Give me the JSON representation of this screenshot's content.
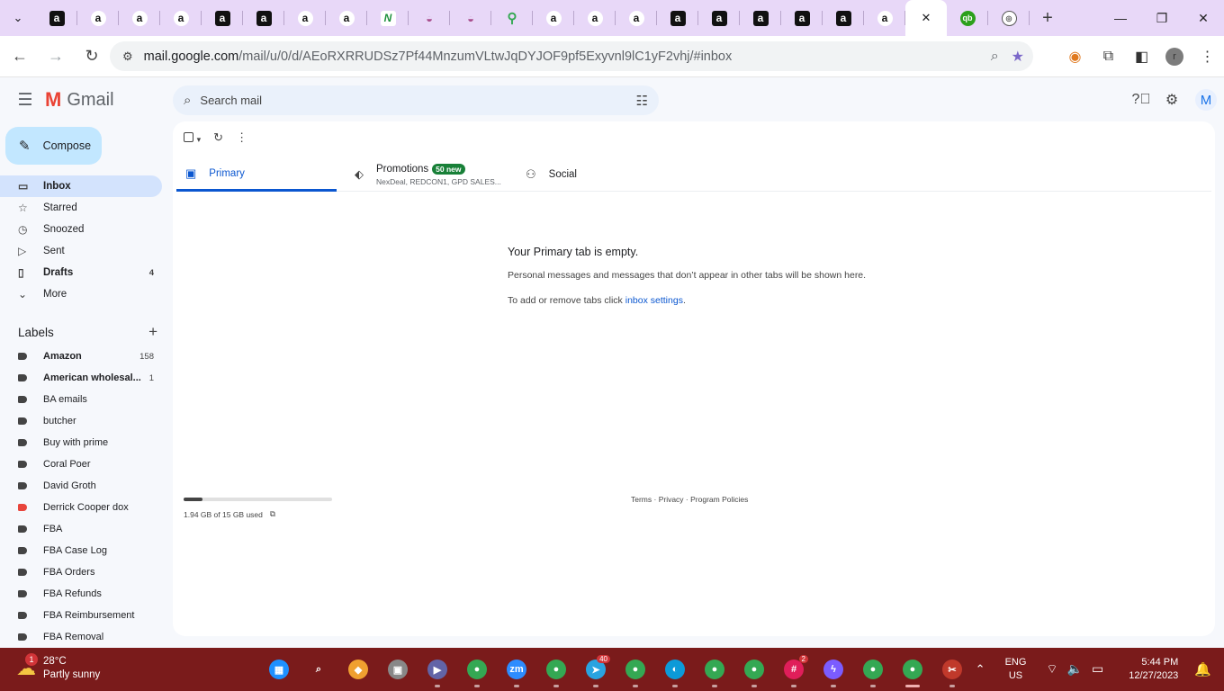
{
  "browser": {
    "tabs": [
      {
        "icon": "amazon-seller-icon",
        "glyph": "a",
        "style": "amz-dark"
      },
      {
        "icon": "amazon-icon",
        "glyph": "a",
        "style": "amz-light"
      },
      {
        "icon": "amazon-icon",
        "glyph": "a",
        "style": "amz-light"
      },
      {
        "icon": "amazon-icon",
        "glyph": "a",
        "style": "amz-light"
      },
      {
        "icon": "amazon-seller-icon",
        "glyph": "a",
        "style": "amz-dark"
      },
      {
        "icon": "amazon-seller-icon",
        "glyph": "a",
        "style": "amz-dark"
      },
      {
        "icon": "amazon-icon",
        "glyph": "a",
        "style": "amz-light"
      },
      {
        "icon": "amazon-icon",
        "glyph": "a",
        "style": "amz-light"
      },
      {
        "icon": "n-icon",
        "glyph": "N",
        "style": "green"
      },
      {
        "icon": "piggy-bank-icon",
        "glyph": "◒",
        "style": "pig"
      },
      {
        "icon": "piggy-bank-icon",
        "glyph": "◒",
        "style": "pig"
      },
      {
        "icon": "maps-pin-icon",
        "glyph": "⚲",
        "style": "maps"
      },
      {
        "icon": "amazon-icon",
        "glyph": "a",
        "style": "amz-light"
      },
      {
        "icon": "amazon-icon",
        "glyph": "a",
        "style": "amz-light"
      },
      {
        "icon": "amazon-icon",
        "glyph": "a",
        "style": "amz-light"
      },
      {
        "icon": "amazon-seller-icon",
        "glyph": "a",
        "style": "amz-dark"
      },
      {
        "icon": "amazon-seller-icon",
        "glyph": "a",
        "style": "amz-dark"
      },
      {
        "icon": "amazon-seller-icon",
        "glyph": "a",
        "style": "amz-dark"
      },
      {
        "icon": "amazon-seller-icon",
        "glyph": "a",
        "style": "amz-dark"
      },
      {
        "icon": "amazon-seller-icon",
        "glyph": "a",
        "style": "amz-dark"
      },
      {
        "icon": "amazon-icon",
        "glyph": "a",
        "style": "amz-light"
      }
    ],
    "active_tab_close": "✕",
    "after_tabs": [
      {
        "icon": "quickbooks-icon",
        "glyph": "qb",
        "style": "qb"
      },
      {
        "icon": "dashboard-icon",
        "glyph": "◎",
        "style": "circ"
      }
    ],
    "new_tab": "+",
    "url_host": "mail.google.com",
    "url_path": "/mail/u/0/d/AEoRXRRUDSz7Pf44MnzumVLtwJqDYJOF9pf5Exyvnl9lC1yF2vhj/#inbox",
    "profile_letter": "r"
  },
  "gmail": {
    "app_name": "Gmail",
    "search_placeholder": "Search mail",
    "account_letter": "M",
    "compose_label": "Compose",
    "nav": [
      {
        "name": "inbox",
        "label": "Inbox",
        "icon": "▭",
        "count": "",
        "active": true
      },
      {
        "name": "starred",
        "label": "Starred",
        "icon": "☆",
        "count": "",
        "active": false
      },
      {
        "name": "snoozed",
        "label": "Snoozed",
        "icon": "◷",
        "count": "",
        "active": false
      },
      {
        "name": "sent",
        "label": "Sent",
        "icon": "▷",
        "count": "",
        "active": false
      },
      {
        "name": "drafts",
        "label": "Drafts",
        "icon": "▯",
        "count": "4",
        "active": false,
        "bold": true
      },
      {
        "name": "more",
        "label": "More",
        "icon": "⌄",
        "count": "",
        "active": false
      }
    ],
    "labels_title": "Labels",
    "labels": [
      {
        "label": "Amazon",
        "count": "158",
        "bold": true,
        "color": "#444444"
      },
      {
        "label": "American wholesal...",
        "count": "1",
        "bold": true,
        "color": "#444444"
      },
      {
        "label": "BA emails",
        "count": "",
        "bold": false,
        "color": "#444444"
      },
      {
        "label": "butcher",
        "count": "",
        "bold": false,
        "color": "#444444"
      },
      {
        "label": "Buy with prime",
        "count": "",
        "bold": false,
        "color": "#444444"
      },
      {
        "label": "Coral Poer",
        "count": "",
        "bold": false,
        "color": "#444444"
      },
      {
        "label": "David Groth",
        "count": "",
        "bold": false,
        "color": "#444444"
      },
      {
        "label": "Derrick Cooper dox",
        "count": "",
        "bold": false,
        "color": "#e8453c"
      },
      {
        "label": "FBA",
        "count": "",
        "bold": false,
        "color": "#444444"
      },
      {
        "label": "FBA Case Log",
        "count": "",
        "bold": false,
        "color": "#444444"
      },
      {
        "label": "FBA Orders",
        "count": "",
        "bold": false,
        "color": "#444444"
      },
      {
        "label": "FBA Refunds",
        "count": "",
        "bold": false,
        "color": "#444444"
      },
      {
        "label": "FBA Reimbursement",
        "count": "",
        "bold": false,
        "color": "#444444"
      },
      {
        "label": "FBA Removal",
        "count": "",
        "bold": false,
        "color": "#444444"
      }
    ],
    "tabs": {
      "primary": "Primary",
      "promotions": "Promotions",
      "promotions_badge": "50 new",
      "promotions_senders": "NexDeal, REDCON1, GPD SALES...",
      "social": "Social"
    },
    "empty_state": {
      "title": "Your Primary tab is empty.",
      "line1": "Personal messages and messages that don’t appear in other tabs will be shown here.",
      "line2_prefix": "To add or remove tabs click ",
      "line2_link": "inbox settings",
      "line2_suffix": "."
    },
    "storage": {
      "text": "1.94 GB of 15 GB used",
      "used_fraction": 0.129
    },
    "footer": "Terms · Privacy · Program Policies"
  },
  "taskbar": {
    "weather_temp": "28°C",
    "weather_desc": "Partly sunny",
    "weather_badge": "1",
    "apps": [
      {
        "name": "start",
        "glyph": "▦",
        "color": "#1e90ff",
        "count": ""
      },
      {
        "name": "search",
        "glyph": "⌕",
        "color": "transparent",
        "count": ""
      },
      {
        "name": "copilot",
        "glyph": "◆",
        "color": "#f0a030",
        "count": ""
      },
      {
        "name": "task-view",
        "glyph": "▣",
        "color": "#888888",
        "count": ""
      },
      {
        "name": "teams-meet",
        "glyph": "▶",
        "color": "#6264a7",
        "count": ""
      },
      {
        "name": "chrome",
        "glyph": "●",
        "color": "#34a853",
        "count": ""
      },
      {
        "name": "zoom",
        "glyph": "zm",
        "color": "#2d8cff",
        "count": ""
      },
      {
        "name": "chrome",
        "glyph": "●",
        "color": "#34a853",
        "count": ""
      },
      {
        "name": "telegram",
        "glyph": "➤",
        "color": "#2aa3e0",
        "count": "40"
      },
      {
        "name": "chrome",
        "glyph": "●",
        "color": "#34a853",
        "count": ""
      },
      {
        "name": "edge",
        "glyph": "◐",
        "color": "#0c9ad8",
        "count": ""
      },
      {
        "name": "chrome",
        "glyph": "●",
        "color": "#34a853",
        "count": ""
      },
      {
        "name": "chrome",
        "glyph": "●",
        "color": "#34a853",
        "count": ""
      },
      {
        "name": "slack",
        "glyph": "#",
        "color": "#e01e5a",
        "count": "2"
      },
      {
        "name": "messenger",
        "glyph": "ϟ",
        "color": "#7b5cff",
        "count": ""
      },
      {
        "name": "chrome",
        "glyph": "●",
        "color": "#34a853",
        "count": ""
      },
      {
        "name": "chrome-active",
        "glyph": "●",
        "color": "#34a853",
        "count": ""
      },
      {
        "name": "snipping-tool",
        "glyph": "✂",
        "color": "#c0392b",
        "count": ""
      }
    ],
    "lang_top": "ENG",
    "lang_bottom": "US",
    "time": "5:44 PM",
    "date": "12/27/2023"
  }
}
